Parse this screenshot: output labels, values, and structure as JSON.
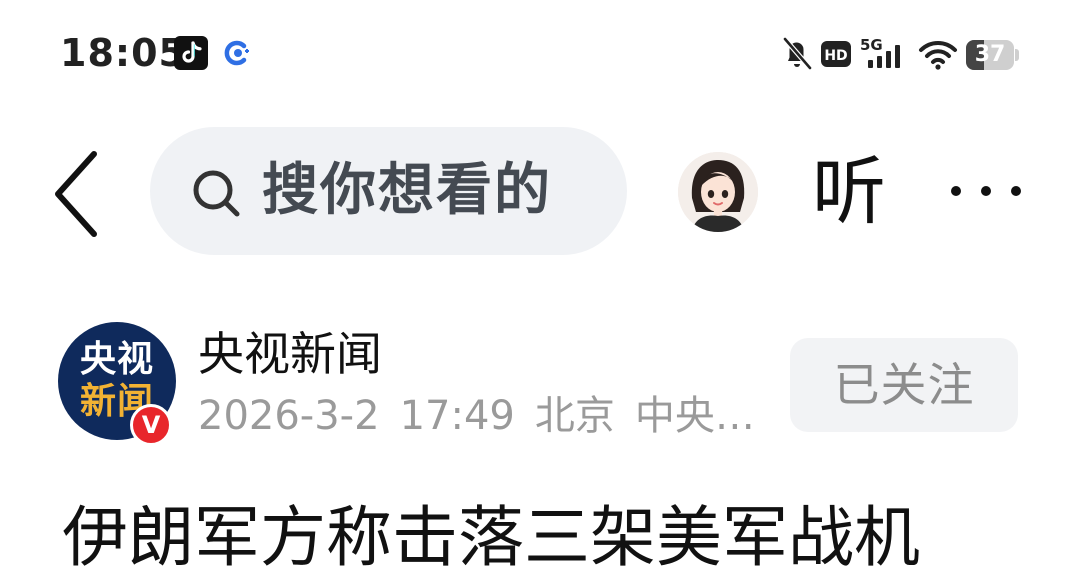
{
  "status_bar": {
    "time": "18:05",
    "apps": [
      "tiktok-icon",
      "browser-icon"
    ],
    "indicators": [
      "mute-icon",
      "hd-icon",
      "signal-5g-icon",
      "wifi-icon"
    ],
    "hd_label": "HD",
    "network_label": "5G",
    "battery_percent": "37",
    "battery_level": 0.37
  },
  "nav": {
    "search_placeholder": "搜你想看的",
    "listen_label": "听",
    "more_label": "···"
  },
  "article": {
    "publisher_logo_line1": "央视",
    "publisher_logo_line2": "新闻",
    "verified_mark": "V",
    "publisher": "央视新闻",
    "date": "2026-3-2",
    "time": "17:49",
    "location": "北京",
    "source": "中央…",
    "follow_label": "已关注",
    "headline": "伊朗军方称击落三架美军战机"
  },
  "colors": {
    "search_bg": "#f0f2f5",
    "logo_bg": "#0f2a5c",
    "logo_accent": "#f2b233",
    "verified": "#e8262b",
    "meta_text": "#9a9a9a"
  }
}
